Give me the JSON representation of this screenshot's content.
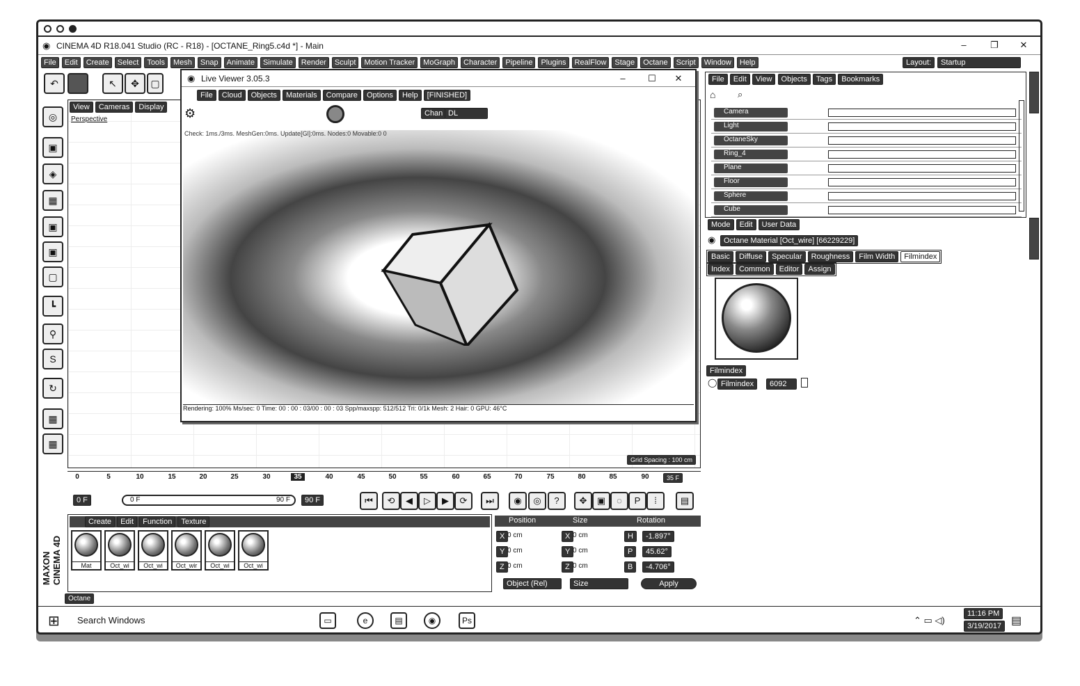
{
  "window": {
    "title": "CINEMA 4D R18.041 Studio (RC - R18) - [OCTANE_Ring5.c4d *] - Main",
    "controls": [
      "–",
      "❐",
      "✕"
    ]
  },
  "menubar": [
    "File",
    "Edit",
    "Create",
    "Select",
    "Tools",
    "Mesh",
    "Snap",
    "Animate",
    "Simulate",
    "Render",
    "Sculpt",
    "Motion Tracker",
    "MoGraph",
    "Character",
    "Pipeline",
    "Plugins",
    "RealFlow",
    "Stage",
    "Octane",
    "Script",
    "Window",
    "Help"
  ],
  "layout": {
    "label": "Layout:",
    "value": "Startup"
  },
  "viewport": {
    "menus": [
      "View",
      "Cameras",
      "Display"
    ],
    "label": "Perspective",
    "grid_spacing": "Grid Spacing : 100 cm"
  },
  "live_viewer": {
    "title": "Live Viewer 3.05.3",
    "menus": [
      "File",
      "Cloud",
      "Objects",
      "Materials",
      "Compare",
      "Options",
      "Help",
      "[FINISHED]"
    ],
    "channel_label": "Chan",
    "channel_value": "DL",
    "check_text": "Check: 1ms./3ms. MeshGen:0ms. Update[Gl]:0ms. Nodes:0 Movable:0 0",
    "status": "Rendering: 100% Ms/sec: 0  Time: 00 : 00 : 03/00 : 00 : 03  Spp/maxspp: 512/512  Tri: 0/1k  Mesh: 2  Hair: 0  GPU: 46°C"
  },
  "object_manager": {
    "menus": [
      "File",
      "Edit",
      "View",
      "Objects",
      "Tags",
      "Bookmarks"
    ],
    "objects": [
      "Camera",
      "Light",
      "OctaneSky",
      "Ring_4",
      "Plane",
      "Floor",
      "Sphere",
      "Cube"
    ]
  },
  "attributes": {
    "menus": [
      "Mode",
      "Edit",
      "User Data"
    ],
    "material_line": "Octane Material [Oct_wire] [66229229]",
    "tabs_row1": [
      "Basic",
      "Diffuse",
      "Specular",
      "Roughness",
      "Film Width",
      "Filmindex"
    ],
    "tabs_row2": [
      "Index",
      "Common",
      "Editor",
      "Assign"
    ],
    "section": "Filmindex",
    "field_label": "Filmindex",
    "field_value": "6092"
  },
  "timeline": {
    "ticks": [
      "0",
      "5",
      "10",
      "15",
      "20",
      "25",
      "30",
      "35",
      "40",
      "45",
      "50",
      "55",
      "60",
      "65",
      "70",
      "75",
      "80",
      "85",
      "90"
    ],
    "current_frame": "35",
    "end_label": "35 F",
    "start_field": "0 F",
    "range_start": "0 F",
    "range_end": "90 F",
    "end_field": "90 F"
  },
  "transport": [
    "⏮",
    "⟲",
    "◀",
    "▷",
    "▶",
    "⟳",
    "⏭"
  ],
  "material_manager": {
    "menus": [
      "Create",
      "Edit",
      "Function",
      "Texture"
    ],
    "materials": [
      "Mat",
      "Oct_wi",
      "Oct_wi",
      "Oct_wir",
      "Oct_wi",
      "Oct_wi"
    ]
  },
  "coordinates": {
    "headers": [
      "Position",
      "Size",
      "Rotation"
    ],
    "rows": [
      {
        "axis": "X",
        "pos": "0 cm",
        "size_axis": "X",
        "size": "0 cm",
        "rot_axis": "H",
        "rot": "-1.897°"
      },
      {
        "axis": "Y",
        "pos": "0 cm",
        "size_axis": "Y",
        "size": "0 cm",
        "rot_axis": "P",
        "rot": "45.62°"
      },
      {
        "axis": "Z",
        "pos": "0 cm",
        "size_axis": "Z",
        "size": "0 cm",
        "rot_axis": "B",
        "rot": "-4.706°"
      }
    ],
    "mode": "Object (Rel)",
    "size_mode": "Size",
    "apply": "Apply"
  },
  "branding": {
    "vertical": "MAXON CINEMA 4D",
    "octane_tab": "Octane"
  },
  "taskbar": {
    "search": "Search Windows",
    "time": "11:16 PM",
    "date": "3/19/2017"
  }
}
